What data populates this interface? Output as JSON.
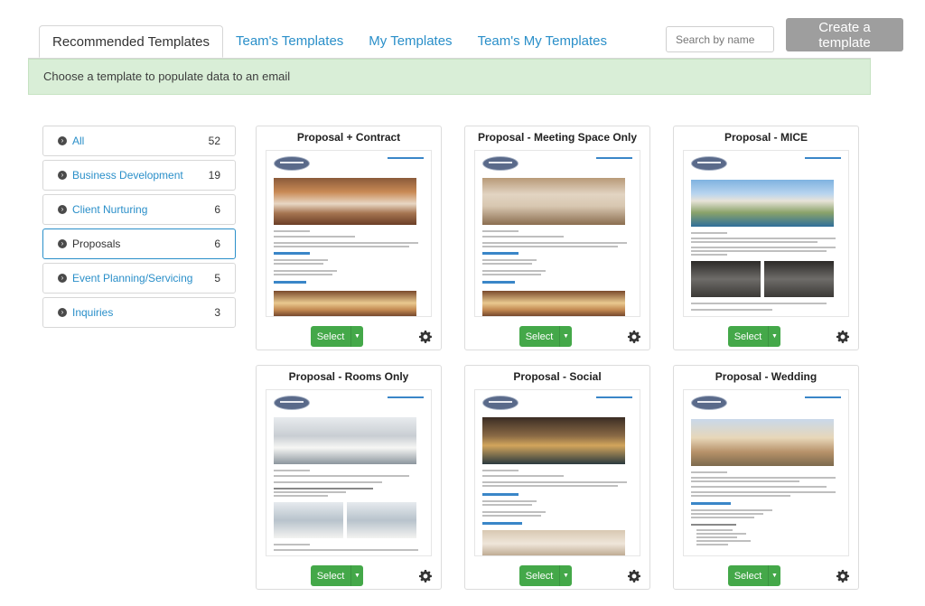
{
  "tabs": [
    {
      "label": "Recommended Templates",
      "active": true
    },
    {
      "label": "Team's Templates",
      "active": false
    },
    {
      "label": "My Templates",
      "active": false
    },
    {
      "label": "Team's My Templates",
      "active": false
    }
  ],
  "search": {
    "placeholder": "Search by name"
  },
  "create_button": {
    "label": "Create a template"
  },
  "alert": {
    "text": "Choose a template to populate data to an email"
  },
  "categories": [
    {
      "label": "All",
      "count": "52",
      "selected": false
    },
    {
      "label": "Business Development",
      "count": "19",
      "selected": false
    },
    {
      "label": "Client Nurturing",
      "count": "6",
      "selected": false
    },
    {
      "label": "Proposals",
      "count": "6",
      "selected": true
    },
    {
      "label": "Event Planning/Servicing",
      "count": "5",
      "selected": false
    },
    {
      "label": "Inquiries",
      "count": "3",
      "selected": false
    }
  ],
  "templates": [
    {
      "title": "Proposal + Contract",
      "select_label": "Select"
    },
    {
      "title": "Proposal - Meeting Space Only",
      "select_label": "Select"
    },
    {
      "title": "Proposal - MICE",
      "select_label": "Select"
    },
    {
      "title": "Proposal - Rooms Only",
      "select_label": "Select"
    },
    {
      "title": "Proposal - Social",
      "select_label": "Select"
    },
    {
      "title": "Proposal - Wedding",
      "select_label": "Select"
    }
  ],
  "icons": {
    "category_bullet": "chevron-circle-right-icon",
    "select_caret": "caret-down-icon",
    "settings": "gear-icon"
  },
  "colors": {
    "link": "#2a8fc9",
    "success": "#44a849",
    "alert_bg": "#d9eed7",
    "create_button_bg": "#9e9e9e"
  }
}
